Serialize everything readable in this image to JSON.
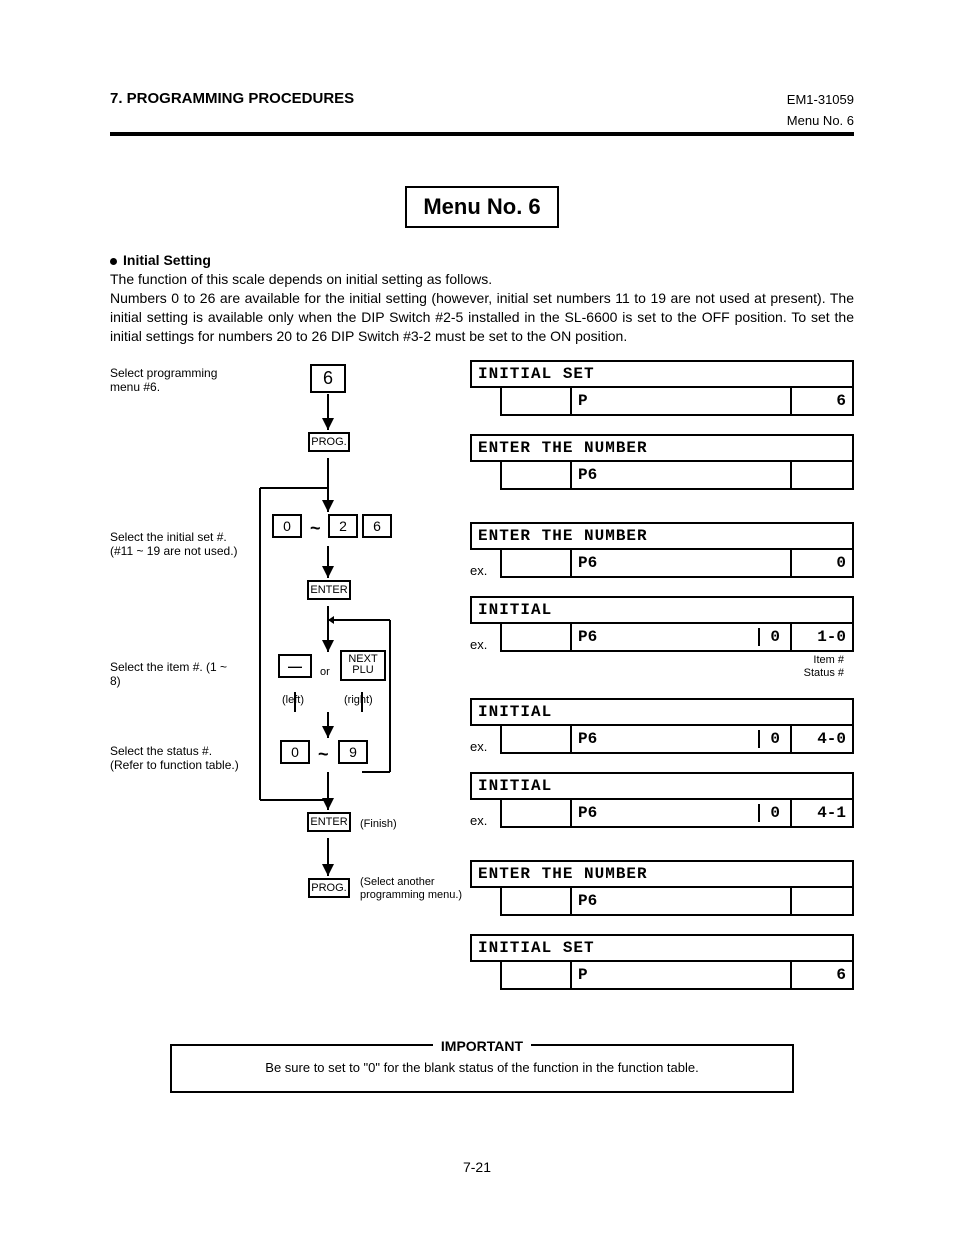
{
  "header": {
    "section_title": "7. PROGRAMMING PROCEDURES",
    "doc_id": "EM1-31059",
    "menu_no": "Menu No. 6"
  },
  "title_box": "Menu No. 6",
  "bullet_title": "Initial Setting",
  "paragraph": "The function of this scale depends on initial setting as follows.\nNumbers 0 to 26 are available for the initial setting (however, initial set numbers 11 to 19 are not used at present).   The initial setting is available only when the DIP Switch #2-5 installed in the SL-6600 is set to the OFF position.  To set the initial settings for numbers 20 to 26 DIP Switch #3-2 must be set to the ON position.",
  "flow": {
    "label1": "Select programming\nmenu #6.",
    "label2": "Select the initial set #.\n(#11 ~ 19 are not used.)",
    "label3": "Select the item #.\n(1 ~ 8)",
    "label4": "Select the status #.\n(Refer to function\ntable.)",
    "box_6": "6",
    "box_prog": "PROG.",
    "box_0": "0",
    "tilde": "~",
    "box_2": "2",
    "box_6b": "6",
    "box_enter": "ENTER",
    "box_minus": "—",
    "or": "or",
    "box_next": "NEXT\nPLU",
    "left": "(left)",
    "right": "(right)",
    "box_0b": "0",
    "box_9": "9",
    "box_enter2": "ENTER",
    "finish": "(Finish)",
    "box_prog2": "PROG.",
    "select_another": "(Select another\nprogramming menu.)"
  },
  "screens": [
    {
      "header": "INITIAL SET",
      "rows": [
        {
          "c1": "",
          "c2": "P",
          "c3": "6"
        }
      ]
    },
    {
      "header": "ENTER THE NUMBER",
      "rows": [
        {
          "c1": "",
          "c2": "P6",
          "c3": ""
        }
      ]
    },
    {
      "gap": true
    },
    {
      "header": "ENTER THE NUMBER",
      "rows": [
        {
          "ex": "ex.",
          "c1": "",
          "c2": "P6",
          "c3": "0"
        }
      ]
    },
    {
      "header": "INITIAL",
      "rows": [
        {
          "ex": "ex.",
          "c1": "",
          "c2a": "P6",
          "c2b": "0",
          "c3": "1-0"
        }
      ],
      "anno": "Item #\nStatus #"
    },
    {
      "header": "INITIAL",
      "rows": [
        {
          "ex": "ex.",
          "c1": "",
          "c2a": "P6",
          "c2b": "0",
          "c3": "4-0"
        }
      ]
    },
    {
      "header": "INITIAL",
      "rows": [
        {
          "ex": "ex.",
          "c1": "",
          "c2a": "P6",
          "c2b": "0",
          "c3": "4-1"
        }
      ]
    },
    {
      "gap": true
    },
    {
      "header": "ENTER THE NUMBER",
      "rows": [
        {
          "c1": "",
          "c2": "P6",
          "c3": ""
        }
      ]
    },
    {
      "header": "INITIAL SET",
      "rows": [
        {
          "c1": "",
          "c2": "P",
          "c3": "6"
        }
      ]
    }
  ],
  "important": {
    "label": "IMPORTANT",
    "text": "Be sure to set to \"0\" for the blank status of the function in the function table."
  },
  "page_number": "7-21"
}
